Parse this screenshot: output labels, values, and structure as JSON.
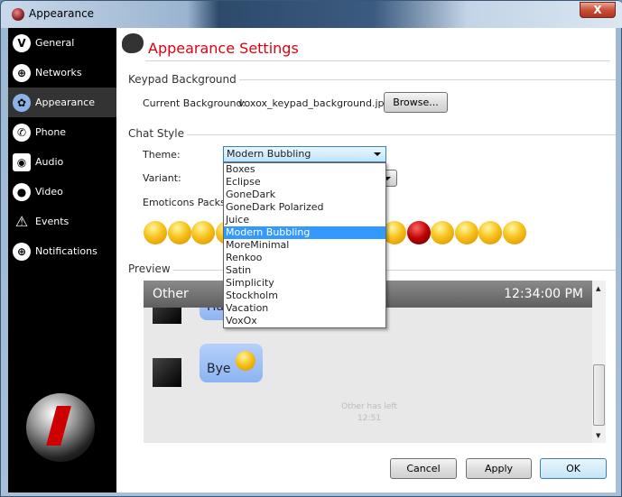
{
  "window": {
    "title": "Appearance",
    "close_label": "X"
  },
  "sidebar": {
    "items": [
      {
        "label": "General",
        "icon": "voxox-icon"
      },
      {
        "label": "Networks",
        "icon": "globe-icon"
      },
      {
        "label": "Appearance",
        "icon": "palette-icon",
        "selected": true
      },
      {
        "label": "Phone",
        "icon": "phone-icon"
      },
      {
        "label": "Audio",
        "icon": "speaker-icon"
      },
      {
        "label": "Video",
        "icon": "webcam-icon"
      },
      {
        "label": "Events",
        "icon": "warning-icon"
      },
      {
        "label": "Notifications",
        "icon": "globe-icon"
      }
    ]
  },
  "main": {
    "title": "Appearance Settings",
    "keypad": {
      "section": "Keypad Background",
      "label": "Current Background:",
      "value": "voxox_keypad_background.jpg",
      "browse": "Browse..."
    },
    "chat": {
      "section": "Chat Style",
      "theme_label": "Theme:",
      "theme_value": "Modern Bubbling",
      "variant_label": "Variant:",
      "emoticons_label": "Emoticons Packs:",
      "theme_options": [
        "Boxes",
        "Eclipse",
        "GoneDark",
        "GoneDark Polarized",
        "Juice",
        "Modern Bubbling",
        "MoreMinimal",
        "Renkoo",
        "Satin",
        "Simplicity",
        "Stockholm",
        "Vacation",
        "VoxOx"
      ],
      "emoticons": [
        "angel",
        "soldier",
        "beer",
        "blush",
        "smile",
        "grin",
        "wink",
        "laugh",
        "shock",
        "cool",
        "cry",
        "devil",
        "confused",
        "hungry",
        "tongue",
        "kiss"
      ]
    },
    "preview": {
      "section": "Preview",
      "name": "Other",
      "time": "12:34:00 PM",
      "msg1": "Hav",
      "msg2": "Bye",
      "status": "Other has left",
      "status_time": "12:51"
    },
    "buttons": {
      "cancel": "Cancel",
      "apply": "Apply",
      "ok": "OK"
    }
  },
  "colors": {
    "title": "#e00010",
    "highlight": "#3399ff",
    "bubble": "#9cbef5"
  }
}
